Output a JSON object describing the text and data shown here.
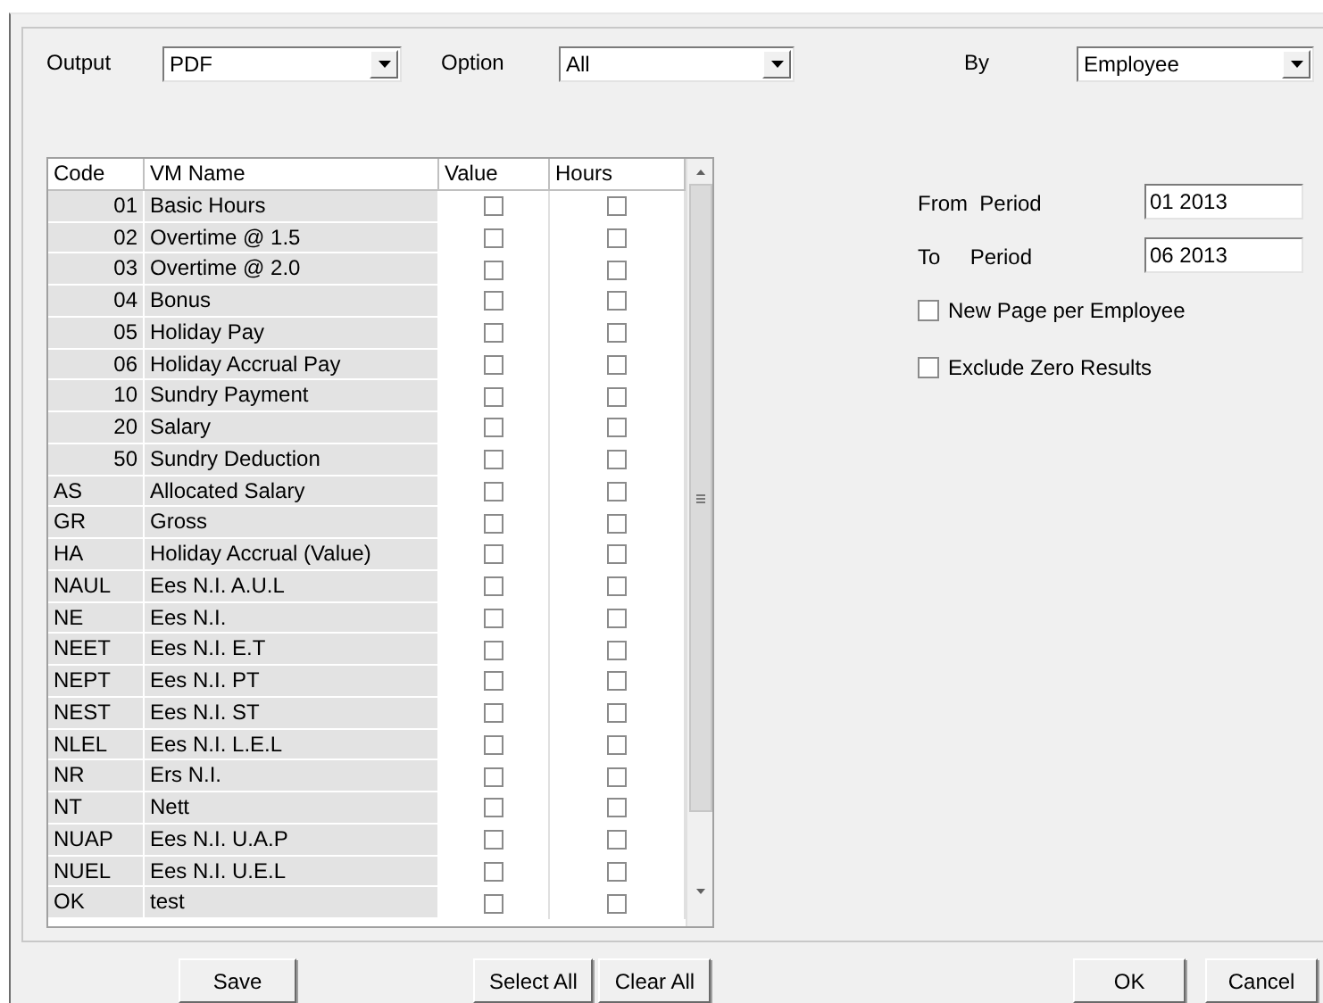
{
  "filters": [
    {
      "label": "Output",
      "value": "PDF"
    },
    {
      "label": "Option",
      "value": "All"
    },
    {
      "label": "By",
      "value": "Employee"
    }
  ],
  "table": {
    "columns": [
      "Code",
      "VM Name",
      "Value",
      "Hours"
    ],
    "rows": [
      {
        "code": "01",
        "kind": "numeric",
        "name": "Basic Hours",
        "value": false,
        "hours": false
      },
      {
        "code": "02",
        "kind": "numeric",
        "name": "Overtime @ 1.5",
        "value": false,
        "hours": false
      },
      {
        "code": "03",
        "kind": "numeric",
        "name": "Overtime @ 2.0",
        "value": false,
        "hours": false
      },
      {
        "code": "04",
        "kind": "numeric",
        "name": "Bonus",
        "value": false,
        "hours": false
      },
      {
        "code": "05",
        "kind": "numeric",
        "name": "Holiday Pay",
        "value": false,
        "hours": false
      },
      {
        "code": "06",
        "kind": "numeric",
        "name": "Holiday Accrual Pay",
        "value": false,
        "hours": false
      },
      {
        "code": "10",
        "kind": "numeric",
        "name": "Sundry Payment",
        "value": false,
        "hours": false
      },
      {
        "code": "20",
        "kind": "numeric",
        "name": "Salary",
        "value": false,
        "hours": false
      },
      {
        "code": "50",
        "kind": "numeric",
        "name": "Sundry Deduction",
        "value": false,
        "hours": false
      },
      {
        "code": "AS",
        "kind": "text",
        "name": "Allocated Salary",
        "value": false,
        "hours": false
      },
      {
        "code": "GR",
        "kind": "text",
        "name": "Gross",
        "value": false,
        "hours": false
      },
      {
        "code": "HA",
        "kind": "text",
        "name": "Holiday Accrual (Value)",
        "value": false,
        "hours": false
      },
      {
        "code": "NAUL",
        "kind": "text",
        "name": "Ees N.I. A.U.L",
        "value": false,
        "hours": false
      },
      {
        "code": "NE",
        "kind": "text",
        "name": "Ees N.I.",
        "value": false,
        "hours": false
      },
      {
        "code": "NEET",
        "kind": "text",
        "name": "Ees N.I. E.T",
        "value": false,
        "hours": false
      },
      {
        "code": "NEPT",
        "kind": "text",
        "name": "Ees N.I. PT",
        "value": false,
        "hours": false
      },
      {
        "code": "NEST",
        "kind": "text",
        "name": "Ees N.I. ST",
        "value": false,
        "hours": false
      },
      {
        "code": "NLEL",
        "kind": "text",
        "name": "Ees N.I. L.E.L",
        "value": false,
        "hours": false
      },
      {
        "code": "NR",
        "kind": "text",
        "name": "Ers N.I.",
        "value": false,
        "hours": false
      },
      {
        "code": "NT",
        "kind": "text",
        "name": "Nett",
        "value": false,
        "hours": false
      },
      {
        "code": "NUAP",
        "kind": "text",
        "name": "Ees N.I. U.A.P",
        "value": false,
        "hours": false
      },
      {
        "code": "NUEL",
        "kind": "text",
        "name": "Ees N.I. U.E.L",
        "value": false,
        "hours": false
      },
      {
        "code": "OK",
        "kind": "text",
        "name": "test",
        "value": false,
        "hours": false
      }
    ]
  },
  "period": {
    "from_label": "From  Period",
    "from_value": "01 2013",
    "to_label": "To     Period",
    "to_value": "06 2013"
  },
  "options": [
    {
      "label": "New Page per Employee",
      "checked": false
    },
    {
      "label": "Exclude Zero Results",
      "checked": false
    }
  ],
  "buttons": {
    "left": [
      "Save"
    ],
    "middle": [
      "Select All",
      "Clear All"
    ],
    "right": [
      "OK",
      "Cancel"
    ]
  }
}
